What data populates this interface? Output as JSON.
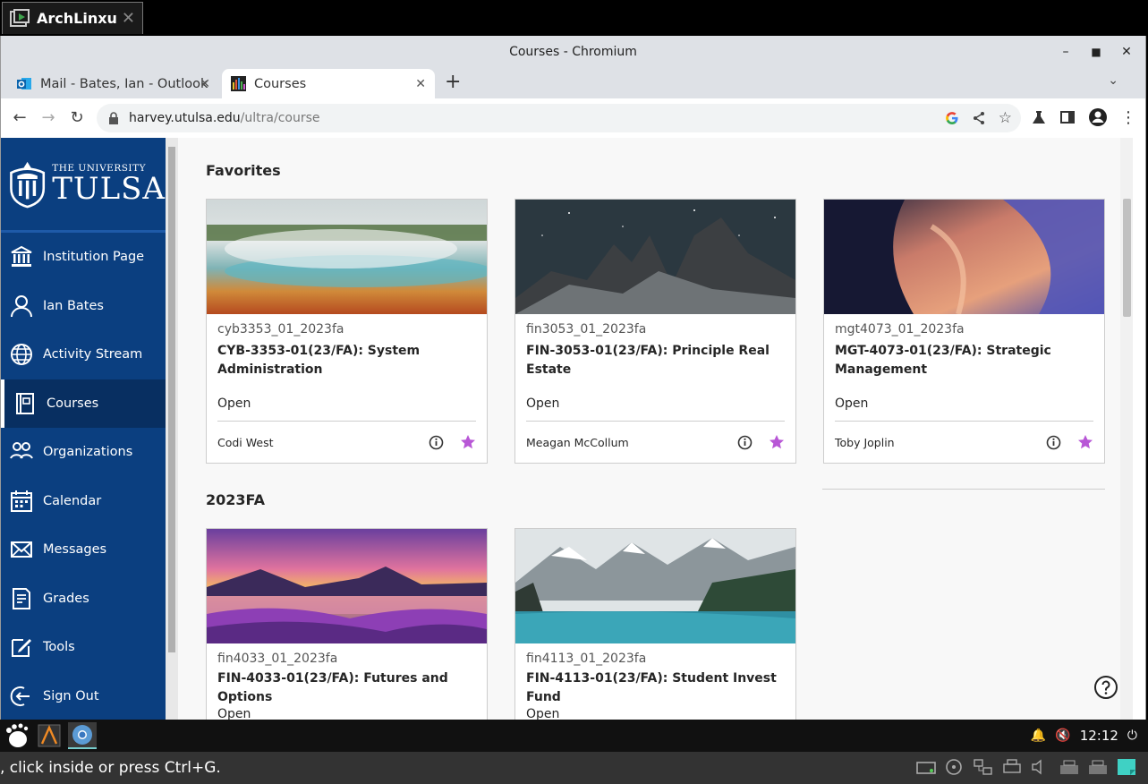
{
  "vm": {
    "tab_title": "ArchLinxu",
    "close_glyph": "✕"
  },
  "window": {
    "title": "Courses - Chromium",
    "minimize": "–",
    "maximize": "▫",
    "close": "✕"
  },
  "tabs": [
    {
      "label": "Mail - Bates, Ian - Outlook",
      "icon": "outlook-icon"
    },
    {
      "label": "Courses",
      "icon": "chart-bars-icon"
    }
  ],
  "toolbar": {
    "new_tab": "+",
    "url_host": "harvey.utulsa.edu",
    "url_path": "/ultra/course"
  },
  "brand": {
    "top": "THE UNIVERSITY",
    "of": "of",
    "name": "TULSA"
  },
  "nav": [
    {
      "label": "Institution Page",
      "icon": "institution-icon"
    },
    {
      "label": "Ian Bates",
      "icon": "user-icon"
    },
    {
      "label": "Activity Stream",
      "icon": "globe-icon"
    },
    {
      "label": "Courses",
      "icon": "courses-icon"
    },
    {
      "label": "Organizations",
      "icon": "organizations-icon"
    },
    {
      "label": "Calendar",
      "icon": "calendar-icon"
    },
    {
      "label": "Messages",
      "icon": "envelope-icon"
    },
    {
      "label": "Grades",
      "icon": "grades-icon"
    },
    {
      "label": "Tools",
      "icon": "tools-icon"
    },
    {
      "label": "Sign Out",
      "icon": "sign-out-icon"
    }
  ],
  "sections": {
    "favorites": "Favorites",
    "term": "2023FA"
  },
  "favorites": [
    {
      "code": "cyb3353_01_2023fa",
      "name": "CYB-3353-01(23/FA): System Administration",
      "status": "Open",
      "instructor": "Codi West",
      "image": "hot-spring"
    },
    {
      "code": "fin3053_01_2023fa",
      "name": "FIN-3053-01(23/FA): Principle Real Estate",
      "status": "Open",
      "instructor": "Meagan McCollum",
      "image": "night-mountains"
    },
    {
      "code": "mgt4073_01_2023fa",
      "name": "MGT-4073-01(23/FA): Strategic Management",
      "status": "Open",
      "instructor": "Toby Joplin",
      "image": "canyon"
    }
  ],
  "term_courses": [
    {
      "code": "fin4033_01_2023fa",
      "name": "FIN-4033-01(23/FA): Futures and Options",
      "status": "Open",
      "image": "lavender-lake"
    },
    {
      "code": "fin4113_01_2023fa",
      "name": "FIN-4113-01(23/FA): Student Invest Fund",
      "status": "Open",
      "image": "alpine-lake"
    }
  ],
  "taskbar": {
    "time": "12:12"
  },
  "statusbar": {
    "message": ", click inside or press Ctrl+G."
  },
  "colors": {
    "sidebar": "#0b3f80",
    "star": "#b857d6",
    "accent": "#1e5aa8"
  }
}
